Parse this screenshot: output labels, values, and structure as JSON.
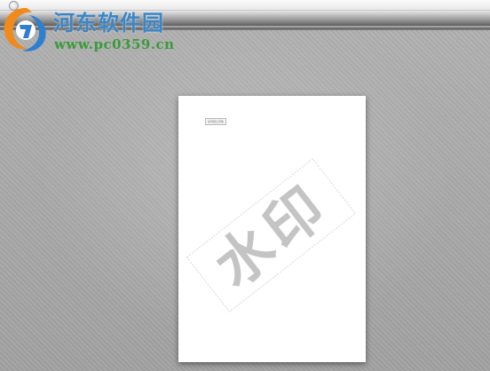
{
  "window": {
    "icon": "app-icon"
  },
  "page": {
    "chip_text": "水印默认字体",
    "watermark_text": "水印"
  },
  "logo": {
    "title": "河东软件园",
    "url": "www.pc0359.cn",
    "title_color": "#3a86c8",
    "url_color": "#3a9b3a"
  },
  "colors": {
    "workspace": "#a9a9a9",
    "watermark": "#c4c4c4"
  }
}
